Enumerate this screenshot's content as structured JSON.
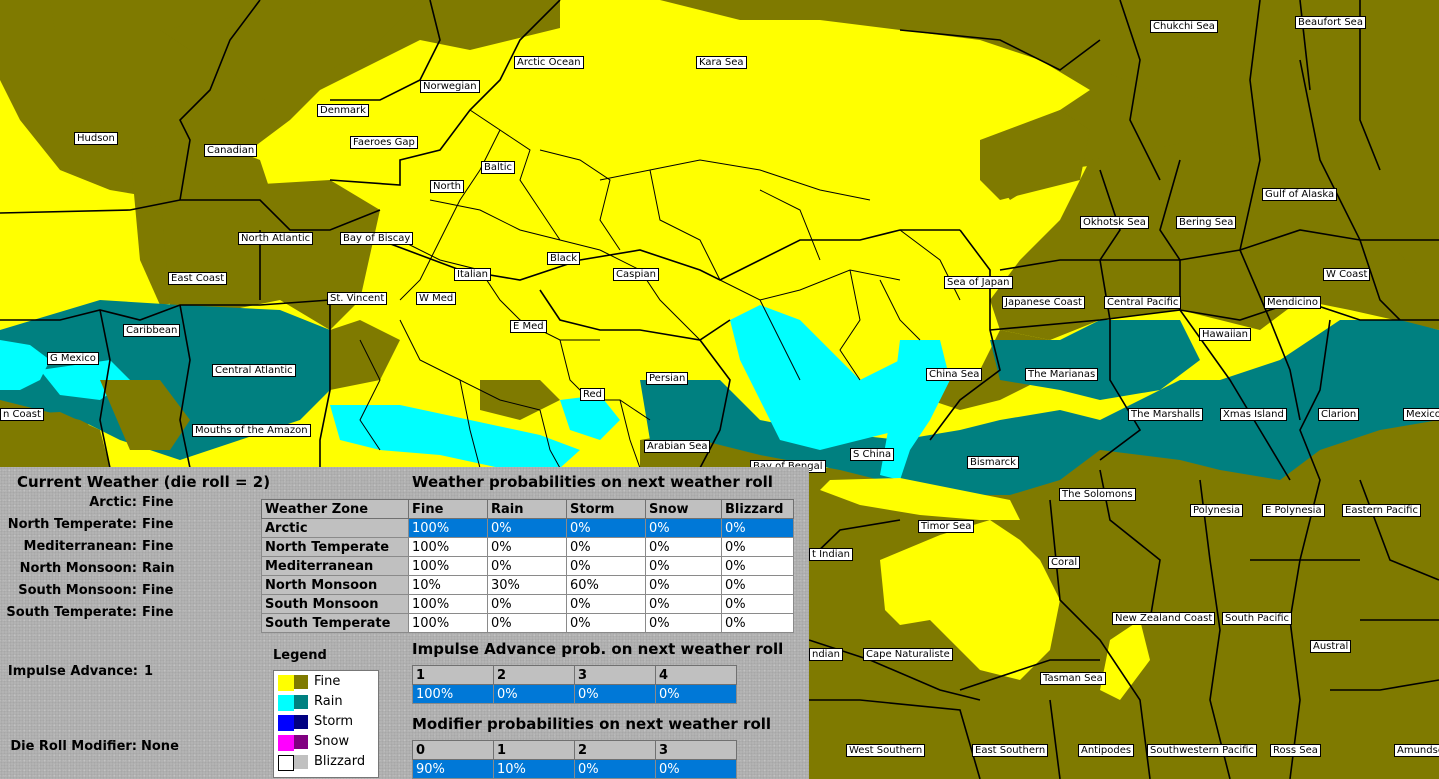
{
  "colors": {
    "fine_light": "#ffff00",
    "fine_dark": "#7f7a00",
    "rain_light": "#00ffff",
    "rain_dark": "#008080",
    "storm_light": "#0000ff",
    "storm_dark": "#000080",
    "snow_light": "#ff00ff",
    "snow_dark": "#800080",
    "blizzard_light": "#ffffff",
    "blizzard_dark": "#c0c0c0",
    "selection": "#0078d7"
  },
  "map_labels": [
    {
      "id": "chukchi-sea",
      "text": "Chukchi Sea"
    },
    {
      "id": "beaufort-sea",
      "text": "Beaufort Sea"
    },
    {
      "id": "arctic-ocean",
      "text": "Arctic Ocean"
    },
    {
      "id": "kara-sea",
      "text": "Kara Sea"
    },
    {
      "id": "norwegian",
      "text": "Norwegian"
    },
    {
      "id": "denmark",
      "text": "Denmark"
    },
    {
      "id": "hudson",
      "text": "Hudson"
    },
    {
      "id": "faeroes-gap",
      "text": "Faeroes Gap"
    },
    {
      "id": "canadian",
      "text": "Canadian"
    },
    {
      "id": "baltic",
      "text": "Baltic"
    },
    {
      "id": "north",
      "text": "North"
    },
    {
      "id": "gulf-of-alaska",
      "text": "Gulf of Alaska"
    },
    {
      "id": "okhotsk-sea",
      "text": "Okhotsk Sea"
    },
    {
      "id": "bering-sea",
      "text": "Bering Sea"
    },
    {
      "id": "north-atlantic",
      "text": "North Atlantic"
    },
    {
      "id": "bay-of-biscay",
      "text": "Bay of Biscay"
    },
    {
      "id": "black",
      "text": "Black"
    },
    {
      "id": "italian",
      "text": "Italian"
    },
    {
      "id": "caspian",
      "text": "Caspian"
    },
    {
      "id": "w-coast",
      "text": "W Coast"
    },
    {
      "id": "east-coast",
      "text": "East Coast"
    },
    {
      "id": "sea-of-japan",
      "text": "Sea of Japan"
    },
    {
      "id": "st-vincent",
      "text": "St. Vincent"
    },
    {
      "id": "w-med",
      "text": "W Med"
    },
    {
      "id": "japanese-coast",
      "text": "Japanese Coast"
    },
    {
      "id": "central-pacific",
      "text": "Central Pacific"
    },
    {
      "id": "mendicino",
      "text": "Mendicino"
    },
    {
      "id": "caribbean",
      "text": "Caribbean"
    },
    {
      "id": "e-med",
      "text": "E Med"
    },
    {
      "id": "hawaiian",
      "text": "Hawaiian"
    },
    {
      "id": "g-mexico",
      "text": "G Mexico"
    },
    {
      "id": "central-atlantic",
      "text": "Central Atlantic"
    },
    {
      "id": "china-sea",
      "text": "China Sea"
    },
    {
      "id": "persian",
      "text": "Persian"
    },
    {
      "id": "the-marianas",
      "text": "The Marianas"
    },
    {
      "id": "red",
      "text": "Red"
    },
    {
      "id": "n-coast",
      "text": "n Coast"
    },
    {
      "id": "the-marshalls",
      "text": "The Marshalls"
    },
    {
      "id": "xmas-island",
      "text": "Xmas Island"
    },
    {
      "id": "clarion",
      "text": "Clarion"
    },
    {
      "id": "mexico",
      "text": "Mexico"
    },
    {
      "id": "mouths-of-the-amazon",
      "text": "Mouths of the Amazon"
    },
    {
      "id": "arabian-sea",
      "text": "Arabian Sea"
    },
    {
      "id": "s-china",
      "text": "S China"
    },
    {
      "id": "bismarck",
      "text": "Bismarck"
    },
    {
      "id": "bay-of-bengal",
      "text": "Bay of Bengal"
    },
    {
      "id": "the-solomons",
      "text": "The Solomons"
    },
    {
      "id": "polynesia",
      "text": "Polynesia"
    },
    {
      "id": "e-polynesia",
      "text": "E Polynesia"
    },
    {
      "id": "eastern-pacific",
      "text": "Eastern Pacific"
    },
    {
      "id": "timor-sea",
      "text": "Timor Sea"
    },
    {
      "id": "t-indian",
      "text": "t Indian"
    },
    {
      "id": "coral",
      "text": "Coral"
    },
    {
      "id": "new-zealand-coast",
      "text": "New Zealand Coast"
    },
    {
      "id": "south-pacific",
      "text": "South Pacific"
    },
    {
      "id": "austral",
      "text": "Austral"
    },
    {
      "id": "ndian",
      "text": "ndian"
    },
    {
      "id": "cape-naturaliste",
      "text": "Cape Naturaliste"
    },
    {
      "id": "tasman-sea",
      "text": "Tasman Sea"
    },
    {
      "id": "west-southern",
      "text": "West Southern"
    },
    {
      "id": "east-southern",
      "text": "East Southern"
    },
    {
      "id": "antipodes",
      "text": "Antipodes"
    },
    {
      "id": "southwestern-pacific",
      "text": "Southwestern Pacific"
    },
    {
      "id": "ross-sea",
      "text": "Ross Sea"
    },
    {
      "id": "amundsen-sea",
      "text": "Amundsen Sea"
    }
  ],
  "current_weather": {
    "title": "Current Weather (die roll = 2)",
    "zones": [
      {
        "label": "Arctic:",
        "value": "Fine"
      },
      {
        "label": "North Temperate:",
        "value": "Fine"
      },
      {
        "label": "Mediterranean:",
        "value": "Fine"
      },
      {
        "label": "North Monsoon:",
        "value": "Rain"
      },
      {
        "label": "South Monsoon:",
        "value": "Fine"
      },
      {
        "label": "South Temperate:",
        "value": "Fine"
      }
    ],
    "impulse_label": "Impulse Advance:",
    "impulse_value": "1",
    "modifier_label": "Die Roll Modifier:",
    "modifier_value": "None"
  },
  "weather_probabilities": {
    "title": "Weather probabilities on next weather roll",
    "headers": [
      "Weather Zone",
      "Fine",
      "Rain",
      "Storm",
      "Snow",
      "Blizzard"
    ],
    "rows": [
      {
        "zone": "Arctic",
        "values": [
          "100%",
          "0%",
          "0%",
          "0%",
          "0%"
        ],
        "selected": true
      },
      {
        "zone": "North Temperate",
        "values": [
          "100%",
          "0%",
          "0%",
          "0%",
          "0%"
        ],
        "selected": false
      },
      {
        "zone": "Mediterranean",
        "values": [
          "100%",
          "0%",
          "0%",
          "0%",
          "0%"
        ],
        "selected": false
      },
      {
        "zone": "North Monsoon",
        "values": [
          "10%",
          "30%",
          "60%",
          "0%",
          "0%"
        ],
        "selected": false
      },
      {
        "zone": "South Monsoon",
        "values": [
          "100%",
          "0%",
          "0%",
          "0%",
          "0%"
        ],
        "selected": false
      },
      {
        "zone": "South Temperate",
        "values": [
          "100%",
          "0%",
          "0%",
          "0%",
          "0%"
        ],
        "selected": false
      }
    ]
  },
  "impulse_probabilities": {
    "title": "Impulse Advance prob. on next weather roll",
    "headers": [
      "1",
      "2",
      "3",
      "4"
    ],
    "values": [
      "100%",
      "0%",
      "0%",
      "0%"
    ]
  },
  "modifier_probabilities": {
    "title": "Modifier probabilities on next weather roll",
    "headers": [
      "0",
      "1",
      "2",
      "3"
    ],
    "values": [
      "90%",
      "10%",
      "0%",
      "0%"
    ]
  },
  "legend": {
    "title": "Legend",
    "items": [
      {
        "name": "Fine",
        "light": "#ffff00",
        "dark": "#7f7a00"
      },
      {
        "name": "Rain",
        "light": "#00ffff",
        "dark": "#008080"
      },
      {
        "name": "Storm",
        "light": "#0000ff",
        "dark": "#000080"
      },
      {
        "name": "Snow",
        "light": "#ff00ff",
        "dark": "#800080"
      },
      {
        "name": "Blizzard",
        "light": "#ffffff",
        "dark": "#c0c0c0"
      }
    ]
  }
}
